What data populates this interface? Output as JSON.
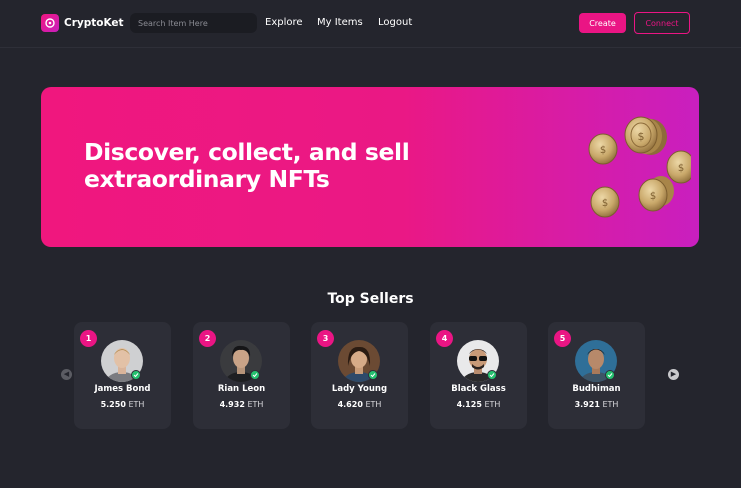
{
  "brand": {
    "name": "CryptoKet"
  },
  "search": {
    "placeholder": "Search Item Here"
  },
  "nav": {
    "explore": "Explore",
    "my_items": "My Items",
    "logout": "Logout"
  },
  "actions": {
    "create": "Create",
    "connect": "Connect"
  },
  "hero": {
    "line1": "Discover, collect, and sell",
    "line2": "extraordinary NFTs"
  },
  "top_sellers": {
    "title": "Top Sellers",
    "currency": "ETH",
    "sellers": [
      {
        "rank": "1",
        "name": "James Bond",
        "amount": "5.250"
      },
      {
        "rank": "2",
        "name": "Rian Leon",
        "amount": "4.932"
      },
      {
        "rank": "3",
        "name": "Lady Young",
        "amount": "4.620"
      },
      {
        "rank": "4",
        "name": "Black Glass",
        "amount": "4.125"
      },
      {
        "rank": "5",
        "name": "Budhiman",
        "amount": "3.921"
      }
    ]
  },
  "colors": {
    "accent": "#ea1584",
    "background": "#24252d",
    "card": "#2d2e37",
    "verified": "#25c16f"
  }
}
